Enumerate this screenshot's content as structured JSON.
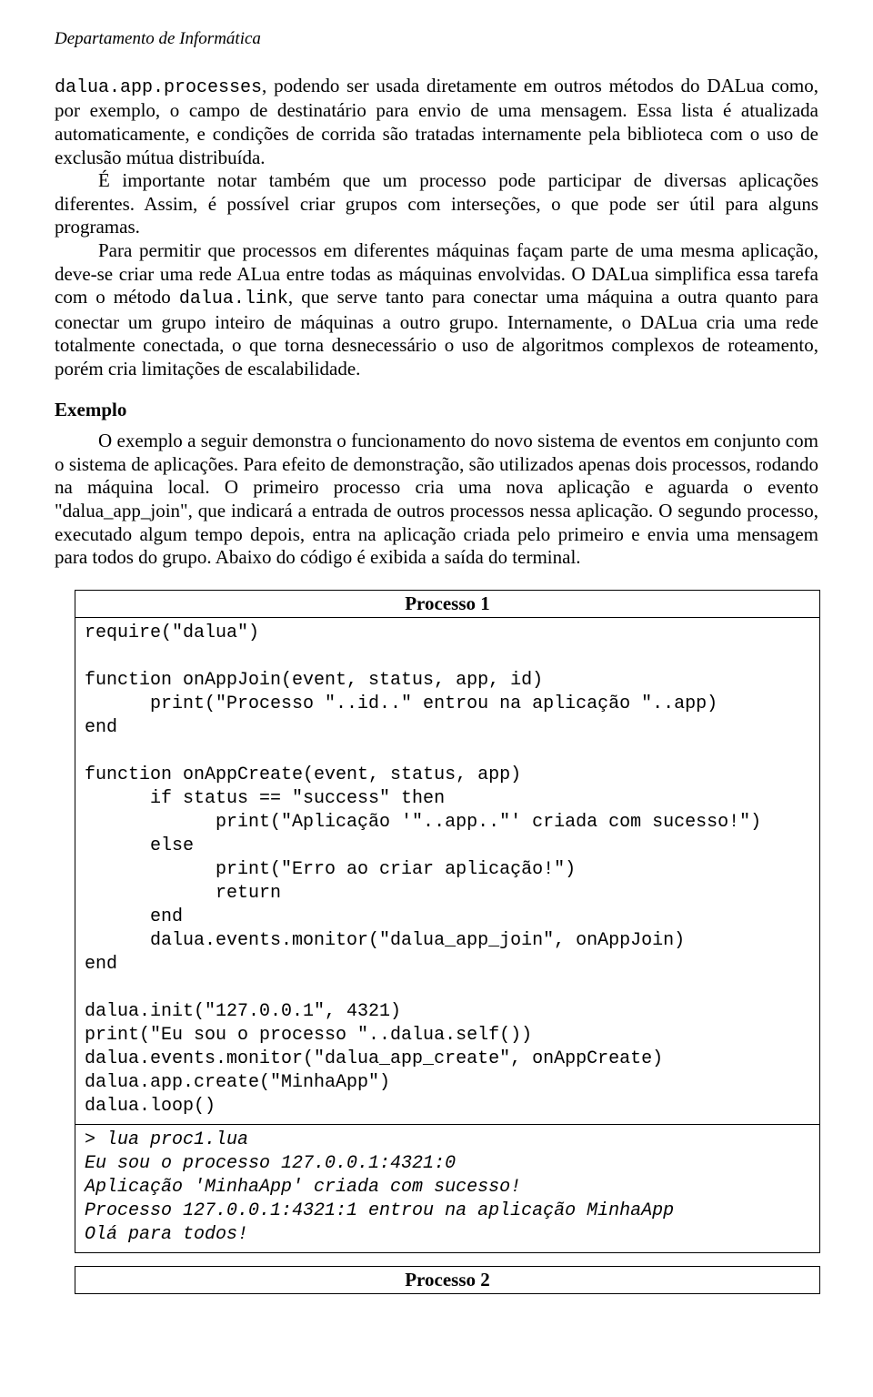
{
  "header": "Departamento de Informática",
  "para1_pre": "dalua.app.processes",
  "para1_post": ", podendo ser usada diretamente em outros métodos do DALua como, por exemplo, o campo de destinatário para envio de uma mensagem. Essa lista é atualizada automaticamente, e condições de corrida são tratadas internamente pela biblioteca com o uso de exclusão mútua distribuída.",
  "para2": "É importante notar também que um processo pode participar de diversas aplicações diferentes. Assim, é possível criar grupos com interseções, o que pode ser útil para alguns programas.",
  "para3_a": "Para permitir que processos em diferentes máquinas façam parte de uma mesma aplicação, deve-se criar uma rede ALua entre todas as máquinas envolvidas. O DALua simplifica essa tarefa com o método ",
  "para3_code": "dalua.link",
  "para3_b": ", que serve tanto para conectar uma máquina a outra quanto para conectar um grupo inteiro de máquinas a outro grupo. Internamente, o DALua cria uma rede totalmente conectada, o que torna desnecessário o uso de algoritmos complexos de roteamento, porém cria limitações de escalabilidade.",
  "section_heading": "Exemplo",
  "para4": "O exemplo a seguir demonstra o funcionamento do novo sistema de eventos em conjunto com o sistema de aplicações. Para efeito de demonstração, são utilizados apenas dois processos, rodando na máquina local. O primeiro processo cria uma nova aplicação e aguarda o evento \"dalua_app_join\", que indicará a entrada de outros processos nessa aplicação. O segundo processo, executado algum tempo depois, entra na aplicação criada pelo primeiro e envia uma mensagem para todos do grupo. Abaixo do código é exibida a saída do terminal.",
  "proc1_title": "Processo 1",
  "proc1_code": "require(\"dalua\")\n\nfunction onAppJoin(event, status, app, id)\n      print(\"Processo \"..id..\" entrou na aplicação \"..app)\nend\n\nfunction onAppCreate(event, status, app)\n      if status == \"success\" then\n            print(\"Aplicação '\"..app..\"' criada com sucesso!\")\n      else\n            print(\"Erro ao criar aplicação!\")\n            return\n      end\n      dalua.events.monitor(\"dalua_app_join\", onAppJoin)\nend\n\ndalua.init(\"127.0.0.1\", 4321)\nprint(\"Eu sou o processo \"..dalua.self())\ndalua.events.monitor(\"dalua_app_create\", onAppCreate)\ndalua.app.create(\"MinhaApp\")\ndalua.loop()",
  "proc1_output": "> lua proc1.lua\nEu sou o processo 127.0.0.1:4321:0\nAplicação 'MinhaApp' criada com sucesso!\nProcesso 127.0.0.1:4321:1 entrou na aplicação MinhaApp\nOlá para todos!",
  "proc2_title": "Processo 2"
}
